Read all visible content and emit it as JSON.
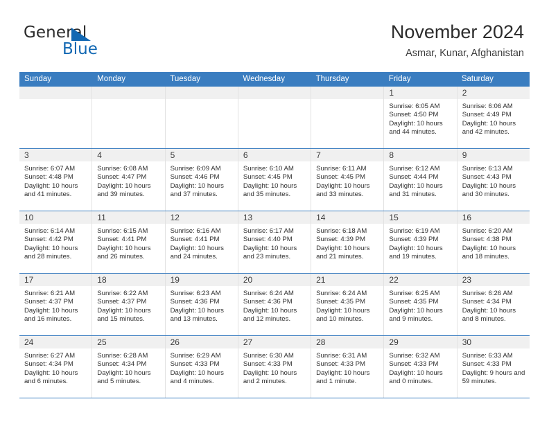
{
  "brand": {
    "name_part1": "General",
    "name_part2": "Blue",
    "triangle_color": "#1268b3"
  },
  "header": {
    "title": "November 2024",
    "location": "Asmar, Kunar, Afghanistan",
    "accent_color": "#3a7dc0"
  },
  "weekdays": [
    "Sunday",
    "Monday",
    "Tuesday",
    "Wednesday",
    "Thursday",
    "Friday",
    "Saturday"
  ],
  "weeks": [
    [
      {
        "day": "",
        "sunrise": "",
        "sunset": "",
        "daylight": "",
        "empty": true
      },
      {
        "day": "",
        "sunrise": "",
        "sunset": "",
        "daylight": "",
        "empty": true
      },
      {
        "day": "",
        "sunrise": "",
        "sunset": "",
        "daylight": "",
        "empty": true
      },
      {
        "day": "",
        "sunrise": "",
        "sunset": "",
        "daylight": "",
        "empty": true
      },
      {
        "day": "",
        "sunrise": "",
        "sunset": "",
        "daylight": "",
        "empty": true
      },
      {
        "day": "1",
        "sunrise": "Sunrise: 6:05 AM",
        "sunset": "Sunset: 4:50 PM",
        "daylight": "Daylight: 10 hours and 44 minutes."
      },
      {
        "day": "2",
        "sunrise": "Sunrise: 6:06 AM",
        "sunset": "Sunset: 4:49 PM",
        "daylight": "Daylight: 10 hours and 42 minutes."
      }
    ],
    [
      {
        "day": "3",
        "sunrise": "Sunrise: 6:07 AM",
        "sunset": "Sunset: 4:48 PM",
        "daylight": "Daylight: 10 hours and 41 minutes."
      },
      {
        "day": "4",
        "sunrise": "Sunrise: 6:08 AM",
        "sunset": "Sunset: 4:47 PM",
        "daylight": "Daylight: 10 hours and 39 minutes."
      },
      {
        "day": "5",
        "sunrise": "Sunrise: 6:09 AM",
        "sunset": "Sunset: 4:46 PM",
        "daylight": "Daylight: 10 hours and 37 minutes."
      },
      {
        "day": "6",
        "sunrise": "Sunrise: 6:10 AM",
        "sunset": "Sunset: 4:45 PM",
        "daylight": "Daylight: 10 hours and 35 minutes."
      },
      {
        "day": "7",
        "sunrise": "Sunrise: 6:11 AM",
        "sunset": "Sunset: 4:45 PM",
        "daylight": "Daylight: 10 hours and 33 minutes."
      },
      {
        "day": "8",
        "sunrise": "Sunrise: 6:12 AM",
        "sunset": "Sunset: 4:44 PM",
        "daylight": "Daylight: 10 hours and 31 minutes."
      },
      {
        "day": "9",
        "sunrise": "Sunrise: 6:13 AM",
        "sunset": "Sunset: 4:43 PM",
        "daylight": "Daylight: 10 hours and 30 minutes."
      }
    ],
    [
      {
        "day": "10",
        "sunrise": "Sunrise: 6:14 AM",
        "sunset": "Sunset: 4:42 PM",
        "daylight": "Daylight: 10 hours and 28 minutes."
      },
      {
        "day": "11",
        "sunrise": "Sunrise: 6:15 AM",
        "sunset": "Sunset: 4:41 PM",
        "daylight": "Daylight: 10 hours and 26 minutes."
      },
      {
        "day": "12",
        "sunrise": "Sunrise: 6:16 AM",
        "sunset": "Sunset: 4:41 PM",
        "daylight": "Daylight: 10 hours and 24 minutes."
      },
      {
        "day": "13",
        "sunrise": "Sunrise: 6:17 AM",
        "sunset": "Sunset: 4:40 PM",
        "daylight": "Daylight: 10 hours and 23 minutes."
      },
      {
        "day": "14",
        "sunrise": "Sunrise: 6:18 AM",
        "sunset": "Sunset: 4:39 PM",
        "daylight": "Daylight: 10 hours and 21 minutes."
      },
      {
        "day": "15",
        "sunrise": "Sunrise: 6:19 AM",
        "sunset": "Sunset: 4:39 PM",
        "daylight": "Daylight: 10 hours and 19 minutes."
      },
      {
        "day": "16",
        "sunrise": "Sunrise: 6:20 AM",
        "sunset": "Sunset: 4:38 PM",
        "daylight": "Daylight: 10 hours and 18 minutes."
      }
    ],
    [
      {
        "day": "17",
        "sunrise": "Sunrise: 6:21 AM",
        "sunset": "Sunset: 4:37 PM",
        "daylight": "Daylight: 10 hours and 16 minutes."
      },
      {
        "day": "18",
        "sunrise": "Sunrise: 6:22 AM",
        "sunset": "Sunset: 4:37 PM",
        "daylight": "Daylight: 10 hours and 15 minutes."
      },
      {
        "day": "19",
        "sunrise": "Sunrise: 6:23 AM",
        "sunset": "Sunset: 4:36 PM",
        "daylight": "Daylight: 10 hours and 13 minutes."
      },
      {
        "day": "20",
        "sunrise": "Sunrise: 6:24 AM",
        "sunset": "Sunset: 4:36 PM",
        "daylight": "Daylight: 10 hours and 12 minutes."
      },
      {
        "day": "21",
        "sunrise": "Sunrise: 6:24 AM",
        "sunset": "Sunset: 4:35 PM",
        "daylight": "Daylight: 10 hours and 10 minutes."
      },
      {
        "day": "22",
        "sunrise": "Sunrise: 6:25 AM",
        "sunset": "Sunset: 4:35 PM",
        "daylight": "Daylight: 10 hours and 9 minutes."
      },
      {
        "day": "23",
        "sunrise": "Sunrise: 6:26 AM",
        "sunset": "Sunset: 4:34 PM",
        "daylight": "Daylight: 10 hours and 8 minutes."
      }
    ],
    [
      {
        "day": "24",
        "sunrise": "Sunrise: 6:27 AM",
        "sunset": "Sunset: 4:34 PM",
        "daylight": "Daylight: 10 hours and 6 minutes."
      },
      {
        "day": "25",
        "sunrise": "Sunrise: 6:28 AM",
        "sunset": "Sunset: 4:34 PM",
        "daylight": "Daylight: 10 hours and 5 minutes."
      },
      {
        "day": "26",
        "sunrise": "Sunrise: 6:29 AM",
        "sunset": "Sunset: 4:33 PM",
        "daylight": "Daylight: 10 hours and 4 minutes."
      },
      {
        "day": "27",
        "sunrise": "Sunrise: 6:30 AM",
        "sunset": "Sunset: 4:33 PM",
        "daylight": "Daylight: 10 hours and 2 minutes."
      },
      {
        "day": "28",
        "sunrise": "Sunrise: 6:31 AM",
        "sunset": "Sunset: 4:33 PM",
        "daylight": "Daylight: 10 hours and 1 minute."
      },
      {
        "day": "29",
        "sunrise": "Sunrise: 6:32 AM",
        "sunset": "Sunset: 4:33 PM",
        "daylight": "Daylight: 10 hours and 0 minutes."
      },
      {
        "day": "30",
        "sunrise": "Sunrise: 6:33 AM",
        "sunset": "Sunset: 4:33 PM",
        "daylight": "Daylight: 9 hours and 59 minutes."
      }
    ]
  ]
}
